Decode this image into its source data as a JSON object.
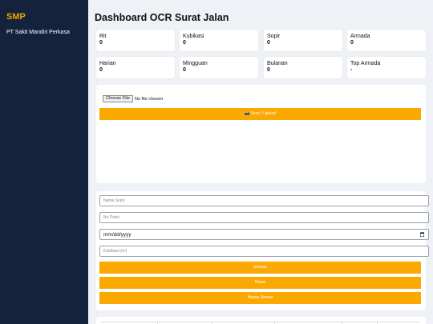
{
  "sidebar": {
    "brand": "SMP",
    "company": "PT Sakti Mandiri Perkasa"
  },
  "header": {
    "title": "Dashboard OCR Surat Jalan"
  },
  "stats": [
    {
      "label": "Rit",
      "value": "0"
    },
    {
      "label": "Kubikasi",
      "value": "0"
    },
    {
      "label": "Sopir",
      "value": "0"
    },
    {
      "label": "Armada",
      "value": "0"
    },
    {
      "label": "Harian",
      "value": "0"
    },
    {
      "label": "Mingguan",
      "value": "0"
    },
    {
      "label": "Bulanan",
      "value": "0"
    },
    {
      "label": "Top Armada",
      "value": "-"
    }
  ],
  "upload": {
    "choose_label": "Choose File",
    "no_file_label": "No file chosen",
    "scan_label": "📷 Scan / Upload"
  },
  "form": {
    "nama_sopir_placeholder": "Nama Sopir",
    "no_polisi_placeholder": "No Polisi",
    "date_value": "mm/dd/yyyy",
    "kubikasi_placeholder": "Kubikasi (m³)",
    "simpan_label": "Simpan",
    "reset_label": "Reset",
    "hapus_label": "Hapus Semua"
  },
  "colors": {
    "sidebar_bg": "#14223c",
    "brand": "#f5a300",
    "accent": "#fba901",
    "page_bg": "#eef1f5"
  }
}
